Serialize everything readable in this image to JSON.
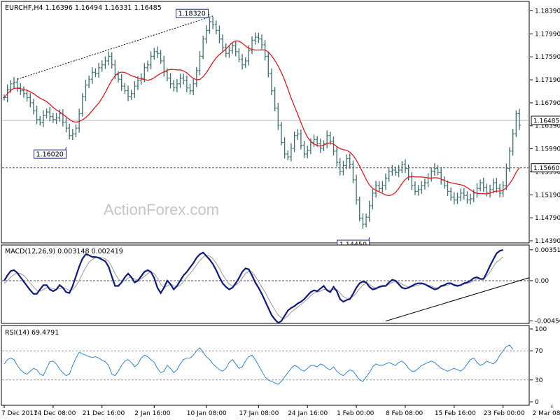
{
  "chart_data": [
    {
      "panel": "price",
      "type": "ohlc",
      "title": "EURCHF,H4  1.16396 1.16494 1.16331 1.16485",
      "watermark": "ActionForex.com",
      "ylim": [
        1.1439,
        1.1853
      ],
      "y_ticks": [
        "1.18390",
        "1.17990",
        "1.17590",
        "1.17190",
        "1.16790",
        "1.16390",
        "1.15990",
        "1.15590",
        "1.15190",
        "1.14790",
        "1.14390"
      ],
      "current_price_label": "1.16485",
      "current_price": 1.16485,
      "support_label": "1.15660",
      "support_level": 1.1566,
      "annotations": [
        {
          "text": "1.18320",
          "value": 1.1832,
          "bar": 63
        },
        {
          "text": "1.16020",
          "value": 1.1602,
          "bar": 19
        },
        {
          "text": "1.14450",
          "value": 1.1445,
          "bar": 112
        }
      ],
      "trendline": {
        "from": {
          "bar": 4,
          "value": 1.172
        },
        "to": {
          "bar": 64,
          "value": 1.183
        },
        "style": "dotted"
      },
      "sma_color": "#e31a1c",
      "bar_color": "#3a6f6f",
      "closes": [
        1.1688,
        1.1702,
        1.1712,
        1.1715,
        1.1705,
        1.17,
        1.1695,
        1.1688,
        1.1679,
        1.1665,
        1.165,
        1.1645,
        1.1657,
        1.1663,
        1.1655,
        1.165,
        1.1653,
        1.166,
        1.1645,
        1.1635,
        1.1622,
        1.1625,
        1.1635,
        1.166,
        1.169,
        1.171,
        1.172,
        1.1732,
        1.173,
        1.174,
        1.1745,
        1.1752,
        1.176,
        1.1745,
        1.1728,
        1.172,
        1.1708,
        1.17,
        1.169,
        1.1695,
        1.1708,
        1.1718,
        1.1722,
        1.174,
        1.1745,
        1.176,
        1.1768,
        1.1765,
        1.1752,
        1.1733,
        1.1722,
        1.1712,
        1.1705,
        1.1712,
        1.1722,
        1.1718,
        1.1705,
        1.17,
        1.1712,
        1.1735,
        1.176,
        1.179,
        1.1805,
        1.182,
        1.1815,
        1.1805,
        1.179,
        1.1775,
        1.1765,
        1.177,
        1.1778,
        1.1768,
        1.1755,
        1.1745,
        1.1752,
        1.177,
        1.1788,
        1.1793,
        1.179,
        1.178,
        1.176,
        1.173,
        1.17,
        1.167,
        1.164,
        1.161,
        1.159,
        1.1585,
        1.16,
        1.1622,
        1.1625,
        1.1605,
        1.159,
        1.1596,
        1.161,
        1.1615,
        1.1608,
        1.16,
        1.1608,
        1.1622,
        1.1612,
        1.1595,
        1.1575,
        1.156,
        1.157,
        1.1582,
        1.1572,
        1.1545,
        1.151,
        1.1478,
        1.1468,
        1.148,
        1.15,
        1.1522,
        1.1535,
        1.153,
        1.1535,
        1.1548,
        1.156,
        1.1562,
        1.1558,
        1.1562,
        1.1572,
        1.1565,
        1.155,
        1.1535,
        1.1525,
        1.1528,
        1.1535,
        1.154,
        1.1548,
        1.156,
        1.1565,
        1.1558,
        1.1545,
        1.1535,
        1.1525,
        1.1515,
        1.151,
        1.1515,
        1.1522,
        1.1518,
        1.151,
        1.1512,
        1.1522,
        1.153,
        1.154,
        1.1532,
        1.1522,
        1.1528,
        1.154,
        1.153,
        1.1522,
        1.1535,
        1.1565,
        1.1595,
        1.1625,
        1.166,
        1.164
      ]
    },
    {
      "panel": "macd",
      "type": "line",
      "title": "MACD(12,26,9) 0.003148 0.002419",
      "ylim": [
        -0.0047,
        0.0039
      ],
      "y_ticks": [
        "0.003516",
        "0.00",
        "-0.004569"
      ],
      "series": [
        {
          "color": "#0d1a80",
          "values": [
            0.0,
            0.0006,
            0.0011,
            0.0012,
            0.0009,
            0.0004,
            -0.0001,
            -0.0006,
            -0.0011,
            -0.0015,
            -0.0015,
            -0.001,
            -0.0005,
            -0.0005,
            -0.001,
            -0.0012,
            -0.001,
            -0.0005,
            -0.0008,
            -0.0013,
            -0.0014,
            -0.0006,
            0.0005,
            0.0016,
            0.0025,
            0.003,
            0.0029,
            0.0027,
            0.0027,
            0.0026,
            0.0024,
            0.0022,
            0.0016,
            0.0005,
            -0.0006,
            -0.0006,
            -0.0002,
            0.0004,
            0.0008,
            0.0004,
            -0.0002,
            0.0,
            0.0005,
            0.001,
            0.0012,
            0.001,
            0.0003,
            -0.0008,
            -0.0014,
            -0.0008,
            0.0,
            -0.0004,
            -0.001,
            -0.0006,
            0.0,
            0.0006,
            0.001,
            0.0015,
            0.002,
            0.0026,
            0.003,
            0.0032,
            0.0028,
            0.0024,
            0.0019,
            0.0012,
            0.0004,
            -0.0003,
            -0.0007,
            -0.001,
            -0.0008,
            -0.0003,
            0.0003,
            0.001,
            0.0014,
            0.0013,
            0.0006,
            -0.0002,
            -0.0008,
            -0.0015,
            -0.0023,
            -0.0031,
            -0.0039,
            -0.0044,
            -0.0048,
            -0.0046,
            -0.004,
            -0.0034,
            -0.0031,
            -0.0029,
            -0.0026,
            -0.0024,
            -0.0021,
            -0.0017,
            -0.0013,
            -0.0011,
            -0.0012,
            -0.0009,
            -0.0006,
            -0.0011,
            -0.0013,
            -0.0007,
            -0.0012,
            -0.0021,
            -0.0024,
            -0.0022,
            -0.0021,
            -0.0015,
            -0.0008,
            -0.0003,
            -0.0001,
            -0.0002,
            -0.0007,
            -0.001,
            -0.0009,
            -0.0007,
            -0.0006,
            -0.0006,
            -0.0002,
            0.0001,
            0.0,
            -0.0004,
            -0.0008,
            -0.0009,
            -0.0008,
            -0.0006,
            -0.0004,
            -0.0003,
            -0.0003,
            -0.0004,
            -0.0006,
            -0.0008,
            -0.001,
            -0.0009,
            -0.0006,
            -0.0005,
            -0.0003,
            -0.0003,
            -0.0005,
            -0.0006,
            -0.0005,
            -0.0003,
            -0.0002,
            0.0,
            0.0003,
            0.0004,
            0.0002,
            0.0002,
            0.0009,
            0.0017,
            0.0024,
            0.0031,
            0.0034,
            0.0035
          ]
        },
        {
          "color": "#9a9a9a",
          "values": [
            -0.0003,
            0.0,
            0.0004,
            0.0007,
            0.0009,
            0.0008,
            0.0006,
            0.0002,
            -0.0003,
            -0.0007,
            -0.0011,
            -0.0012,
            -0.001,
            -0.0008,
            -0.0008,
            -0.0009,
            -0.001,
            -0.0009,
            -0.0008,
            -0.0009,
            -0.0011,
            -0.001,
            -0.0006,
            0.0,
            0.0008,
            0.0015,
            0.0021,
            0.0024,
            0.0026,
            0.0027,
            0.0026,
            0.0025,
            0.0022,
            0.0016,
            0.0008,
            0.0002,
            -0.0001,
            0.0,
            0.0003,
            0.0004,
            0.0002,
            0.0001,
            0.0002,
            0.0005,
            0.0008,
            0.001,
            0.0008,
            0.0003,
            -0.0004,
            -0.0008,
            -0.0006,
            -0.0004,
            -0.0006,
            -0.0007,
            -0.0005,
            -0.0001,
            0.0004,
            0.0008,
            0.0013,
            0.0018,
            0.0023,
            0.0027,
            0.0029,
            0.0028,
            0.0025,
            0.002,
            0.0014,
            0.0007,
            0.0001,
            -0.0004,
            -0.0006,
            -0.0005,
            -0.0002,
            0.0003,
            0.0008,
            0.0011,
            0.001,
            0.0005,
            -0.0001,
            -0.0007,
            -0.0013,
            -0.002,
            -0.0027,
            -0.0033,
            -0.0039,
            -0.0042,
            -0.0043,
            -0.004,
            -0.0036,
            -0.0033,
            -0.003,
            -0.0027,
            -0.0024,
            -0.0021,
            -0.0017,
            -0.0014,
            -0.0013,
            -0.0012,
            -0.001,
            -0.001,
            -0.0011,
            -0.001,
            -0.001,
            -0.0014,
            -0.0018,
            -0.002,
            -0.002,
            -0.0018,
            -0.0014,
            -0.0009,
            -0.0005,
            -0.0003,
            -0.0004,
            -0.0007,
            -0.0008,
            -0.0008,
            -0.0007,
            -0.0006,
            -0.0004,
            -0.0002,
            -0.0001,
            -0.0002,
            -0.0004,
            -0.0006,
            -0.0007,
            -0.0007,
            -0.0006,
            -0.0005,
            -0.0004,
            -0.0004,
            -0.0005,
            -0.0006,
            -0.0008,
            -0.0008,
            -0.0007,
            -0.0006,
            -0.0005,
            -0.0004,
            -0.0004,
            -0.0005,
            -0.0005,
            -0.0004,
            -0.0003,
            -0.0002,
            0.0,
            0.0002,
            0.0002,
            0.0002,
            0.0005,
            0.001,
            0.0016,
            0.0021,
            0.0024,
            0.0027
          ]
        }
      ],
      "trendline": {
        "from": {
          "bar": 117,
          "value": -0.0046
        },
        "to": {
          "bar": 170,
          "value": 0.0001
        }
      }
    },
    {
      "panel": "rsi",
      "type": "line",
      "title": "RSI(14) 69.4791",
      "ylim": [
        0,
        100
      ],
      "y_ticks": [
        "100",
        "70",
        "30",
        "0"
      ],
      "levels": [
        70,
        30
      ],
      "series": [
        {
          "color": "#2e86d6",
          "values": [
            52,
            58,
            60,
            58,
            50,
            44,
            40,
            38,
            42,
            46,
            44,
            38,
            36,
            46,
            55,
            56,
            52,
            45,
            40,
            36,
            38,
            50,
            60,
            68,
            66,
            64,
            62,
            61,
            62,
            60,
            57,
            55,
            50,
            38,
            36,
            42,
            50,
            56,
            58,
            54,
            48,
            52,
            60,
            64,
            62,
            58,
            54,
            46,
            40,
            42,
            50,
            46,
            40,
            44,
            52,
            58,
            60,
            60,
            64,
            70,
            74,
            68,
            62,
            58,
            52,
            48,
            44,
            42,
            46,
            54,
            58,
            52,
            46,
            48,
            56,
            62,
            64,
            58,
            50,
            42,
            34,
            30,
            28,
            26,
            24,
            28,
            34,
            40,
            46,
            50,
            48,
            44,
            42,
            46,
            50,
            50,
            48,
            52,
            50,
            46,
            44,
            48,
            42,
            38,
            36,
            40,
            44,
            42,
            36,
            30,
            28,
            34,
            40,
            48,
            52,
            50,
            50,
            52,
            54,
            52,
            50,
            54,
            56,
            52,
            46,
            42,
            42,
            46,
            50,
            52,
            54,
            56,
            54,
            50,
            46,
            44,
            42,
            44,
            46,
            44,
            42,
            46,
            52,
            58,
            60,
            54,
            50,
            52,
            56,
            54,
            52,
            56,
            64,
            70,
            76,
            78,
            72
          ]
        }
      ]
    }
  ],
  "x_axis_labels": [
    "7 Dec 2017",
    "14 Dec 08:00",
    "21 Dec 16:00",
    "2 Jan 16:00",
    "10 Jan 08:00",
    "17 Jan 08:00",
    "24 Jan 16:00",
    "1 Feb 00:00",
    "8 Feb 08:00",
    "15 Feb 16:00",
    "23 Feb 00:00",
    "2 Mar 08:00"
  ],
  "x_axis_label_bars": [
    0,
    15,
    30,
    46,
    62,
    78,
    93,
    108,
    123,
    138,
    153,
    168
  ]
}
